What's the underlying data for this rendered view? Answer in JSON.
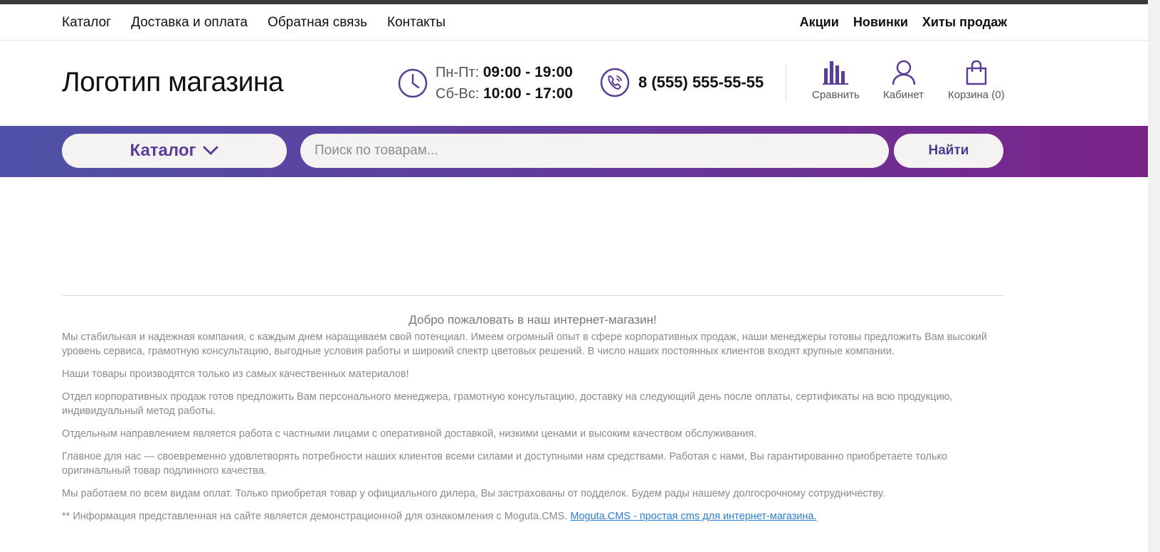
{
  "topnav": {
    "left": [
      "Каталог",
      "Доставка и оплата",
      "Обратная связь",
      "Контакты"
    ],
    "right": [
      "Акции",
      "Новинки",
      "Хиты продаж"
    ]
  },
  "header": {
    "logo": "Логотип магазина",
    "hours": {
      "weekday_label": "Пн-Пт:",
      "weekday_time": "09:00 - 19:00",
      "weekend_label": "Сб-Вс:",
      "weekend_time": "10:00 - 17:00"
    },
    "phone": "8 (555) 555-55-55",
    "buttons": {
      "compare": "Сравнить",
      "cabinet": "Кабинет",
      "cart": "Корзина (0)"
    }
  },
  "bar": {
    "catalog_label": "Каталог",
    "search_placeholder": "Поиск по товарам...",
    "search_value": "",
    "find_label": "Найти"
  },
  "main": {
    "welcome_title": "Добро пожаловать в наш интернет-магазин!",
    "paragraphs": [
      "Мы стабильная и надежная компания, с каждым днем наращиваем свой потенциал. Имеем огромный опыт в сфере корпоративных продаж, наши менеджеры готовы предложить Вам высокий уровень сервиса, грамотную консультацию, выгодные условия работы и широкий спектр цветовых решений. В число наших постоянных клиентов входят крупные компании.",
      "Наши товары производятся только из самых качественных материалов!",
      "Отдел корпоративных продаж готов предложить Вам персонального менеджера, грамотную консультацию, доставку на следующий день после оплаты, сертификаты на всю продукцию, индивидуальный метод работы.",
      "Отдельным направлением является работа с частными лицами с оперативной доставкой, низкими ценами и высоким качеством обслуживания.",
      "Главное для нас — своевременно удовлетворять потребности наших клиентов всеми силами и доступными нам средствами. Работая с нами, Вы гарантированно приобретаете только оригинальный товар подлинного качества.",
      "Мы работаем по всем видам оплат. Только приобретая товар у официального дилера, Вы застрахованы от подделок. Будем рады нашему долгосрочному сотрудничеству."
    ],
    "footnote_text": "** Информация представленная на сайте является демонстрационной для ознакомления с Moguta.CMS.",
    "footnote_link": "Moguta.CMS - простая cms для интернет-магазина."
  },
  "colors": {
    "accent": "#5a3d97",
    "bar_start": "#4f52a8",
    "bar_end": "#7a2389",
    "link": "#2a7fd4"
  },
  "icons": [
    "clock-icon",
    "phone-icon",
    "compare-chart-icon",
    "user-icon",
    "shopping-bag-icon",
    "chevron-down-icon"
  ]
}
